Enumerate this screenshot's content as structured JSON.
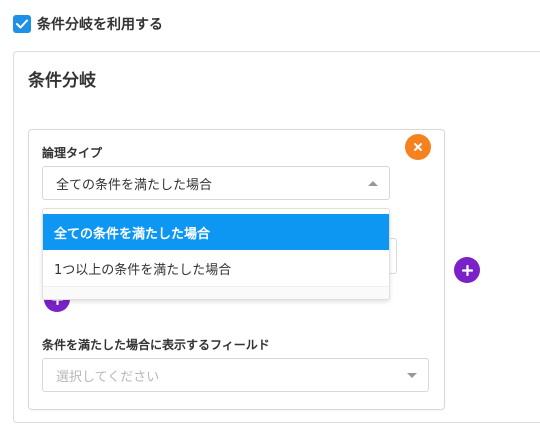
{
  "enable": {
    "checked": true,
    "label": "条件分岐を利用する"
  },
  "panel": {
    "title": "条件分岐"
  },
  "condition": {
    "logic_type_label": "論理タイプ",
    "logic_type_value": "全ての条件を満たした場合",
    "options": [
      {
        "label": "全ての条件を満たした場合",
        "selected": true
      },
      {
        "label": "1つ以上の条件を満たした場合",
        "selected": false
      }
    ],
    "display_field_label": "条件を満たした場合に表示するフィールド",
    "display_field_placeholder": "選択してください"
  },
  "icons": {
    "checkbox": "check-icon",
    "close": "close-icon",
    "add": "plus-icon",
    "caret_up": "caret-up-icon",
    "caret_down": "caret-down-icon"
  },
  "colors": {
    "checkbox": "#1e90e6",
    "close": "#f5821f",
    "add": "#7a22c7",
    "selected_option": "#0d96f2"
  }
}
